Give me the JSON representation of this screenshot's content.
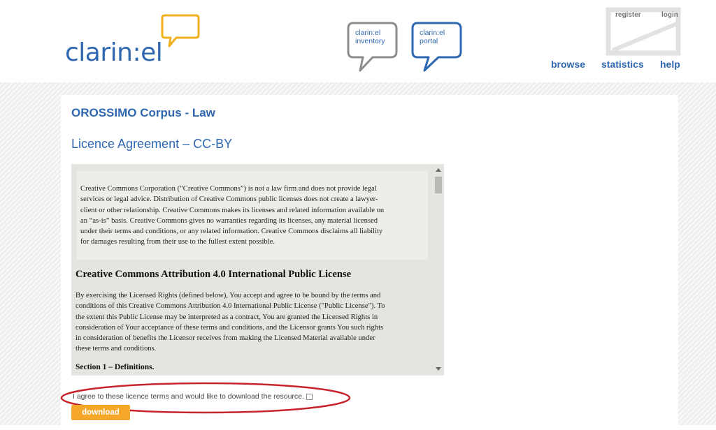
{
  "header": {
    "logo_text": "clarin:el",
    "inventory_bubble": "clarin:el\ninventory",
    "portal_bubble": "clarin:el\nportal",
    "register_label": "register",
    "login_label": "login",
    "nav": {
      "browse": "browse",
      "statistics": "statistics",
      "help": "help"
    },
    "colors": {
      "brand_blue": "#2f68b0",
      "logo_bubble": "#f2b01e",
      "inventory_bubble": "#8c8c8c"
    }
  },
  "resource": {
    "title": "OROSSIMO Corpus - Law",
    "licence_title": "Licence Agreement – CC-BY"
  },
  "licence": {
    "notice_lines": [
      "Creative Commons Corporation (“Creative Commons”) is not a law firm and does not provide legal",
      "services or legal advice. Distribution of Creative Commons public licenses does not create a lawyer-",
      "client or other relationship. Creative Commons makes its licenses and related information available on",
      "an “as-is” basis. Creative Commons gives no warranties regarding its licenses, any material licensed",
      "under their terms and conditions, or any related information. Creative Commons disclaims all liability",
      "for damages resulting from their use to the fullest extent possible."
    ],
    "heading": "Creative Commons Attribution 4.0 International Public License",
    "body_lines": [
      "By exercising the Licensed Rights (defined below), You accept and agree to be bound by the terms and",
      "conditions of this Creative Commons Attribution 4.0 International Public License (\"Public License\"). To",
      "the extent this Public License may be interpreted as a contract, You are granted the Licensed Rights in",
      "consideration of Your acceptance of these terms and conditions, and the Licensor grants You such rights",
      "in consideration of benefits the Licensor receives from making the Licensed Material available under",
      "these terms and conditions."
    ],
    "section_heading": "Section 1 – Definitions."
  },
  "agreement": {
    "label": "I agree to these licence terms and would like to download the resource.",
    "checked": false,
    "highlight_color": "#c8222b"
  },
  "download_button": {
    "label": "download",
    "color": "#f5a72a"
  }
}
